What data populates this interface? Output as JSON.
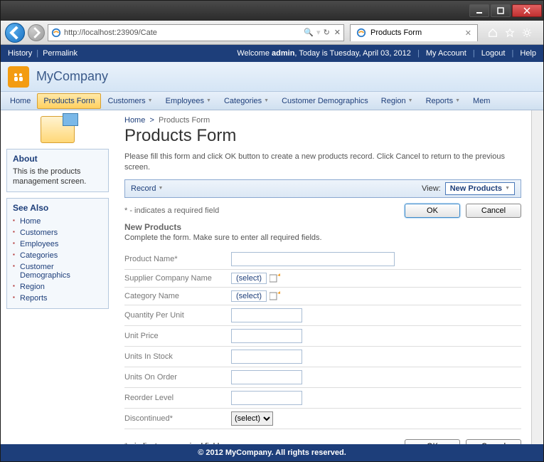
{
  "browser": {
    "url": "http://localhost:23909/Cate",
    "tab_title": "Products Form"
  },
  "topbar": {
    "history": "History",
    "permalink": "Permalink",
    "welcome_prefix": "Welcome ",
    "welcome_user": "admin",
    "welcome_date": ", Today is Tuesday, April 03, 2012",
    "my_account": "My Account",
    "logout": "Logout",
    "help": "Help"
  },
  "brand": "MyCompany",
  "menu": {
    "home": "Home",
    "products_form": "Products Form",
    "customers": "Customers",
    "employees": "Employees",
    "categories": "Categories",
    "customer_demographics": "Customer Demographics",
    "region": "Region",
    "reports": "Reports",
    "members": "Mem"
  },
  "sidebar": {
    "about_title": "About",
    "about_text": "This is the products management screen.",
    "seealso_title": "See Also",
    "links": {
      "home": "Home",
      "customers": "Customers",
      "employees": "Employees",
      "categories": "Categories",
      "customer_demographics": "Customer Demographics",
      "region": "Region",
      "reports": "Reports"
    }
  },
  "page": {
    "breadcrumb_home": "Home",
    "breadcrumb_current": "Products Form",
    "title": "Products Form",
    "intro": "Please fill this form and click OK button to create a new products record. Click Cancel to return to the previous screen.",
    "record_label": "Record",
    "view_label": "View:",
    "view_value": "New Products",
    "required_hint": "* - indicates a required field",
    "ok": "OK",
    "cancel": "Cancel",
    "section_title": "New Products",
    "section_sub": "Complete the form. Make sure to enter all required fields.",
    "fields": {
      "product_name": "Product Name",
      "supplier": "Supplier Company Name",
      "category": "Category Name",
      "qty": "Quantity Per Unit",
      "price": "Unit Price",
      "stock": "Units In Stock",
      "order": "Units On Order",
      "reorder": "Reorder Level",
      "discontinued": "Discontinued"
    },
    "select_placeholder": "(select)",
    "required_marker": "*"
  },
  "footer": "© 2012 MyCompany. All rights reserved."
}
